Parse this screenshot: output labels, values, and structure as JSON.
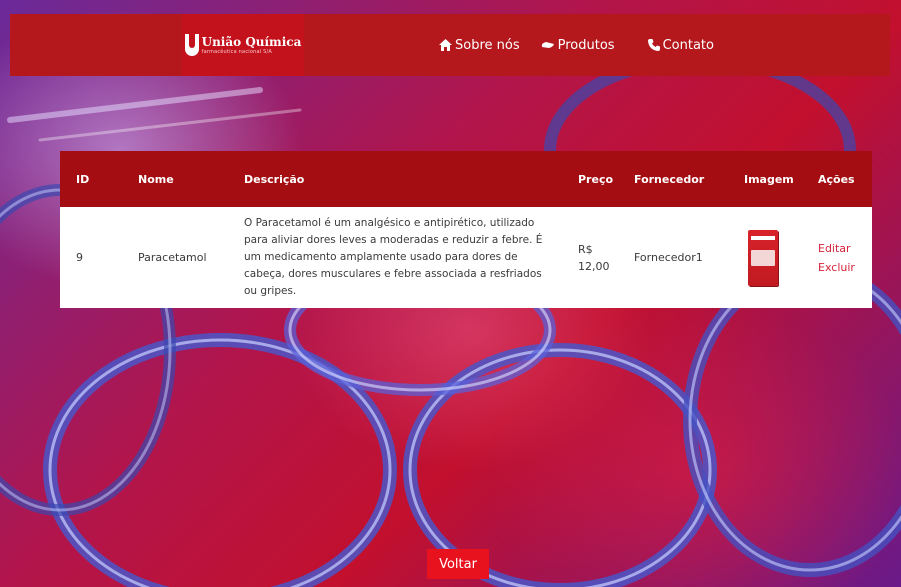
{
  "brand": {
    "name": "União Química",
    "tagline": "farmacêutica nacional S/A"
  },
  "nav": {
    "items": [
      {
        "label": "Sobre nós",
        "icon": "home-icon"
      },
      {
        "label": "Produtos",
        "icon": "pill-icon"
      },
      {
        "label": "Contato",
        "icon": "phone-icon"
      }
    ]
  },
  "table": {
    "headers": [
      "ID",
      "Nome",
      "Descrição",
      "Preço",
      "Fornecedor",
      "Imagem",
      "Ações"
    ],
    "rows": [
      {
        "id": "9",
        "name": "Paracetamol",
        "description": "O Paracetamol é um analgésico e antipirético, utilizado para aliviar dores leves a moderadas e reduzir a febre. É um medicamento amplamente usado para dores de cabeça, dores musculares e febre associada a resfriados ou gripes.",
        "price": "R$ 12,00",
        "supplier": "Fornecedor1",
        "image_icon": "paracetamol-box-image",
        "actions": {
          "edit": "Editar",
          "delete": "Excluir"
        }
      }
    ]
  },
  "back_button": "Voltar",
  "colors": {
    "header": "#b4181c",
    "table_header": "#a40e12",
    "accent": "#e8121f",
    "action_link": "#d6233a"
  }
}
